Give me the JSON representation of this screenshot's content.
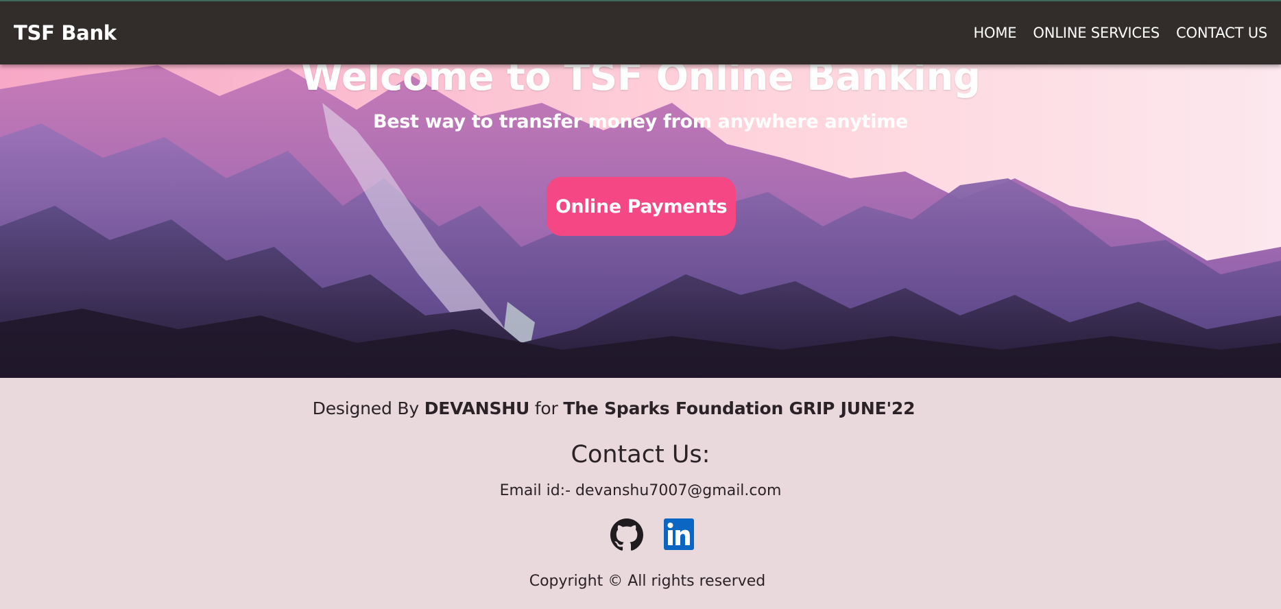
{
  "navbar": {
    "brand": "TSF Bank",
    "links": [
      "HOME",
      "ONLINE SERVICES",
      "CONTACT US"
    ]
  },
  "hero": {
    "title": "Welcome to TSF Online Banking",
    "subtitle": "Best way to transfer money from anywhere anytime",
    "cta_label": "Online Payments"
  },
  "footer": {
    "credit_prefix": "Designed By ",
    "credit_author": "DEVANSHU",
    "credit_middle": " for ",
    "credit_org": "The Sparks Foundation GRIP JUNE'22",
    "contact_heading": "Contact Us:",
    "email_line": "Email id:- devanshu7007@gmail.com",
    "social_icons": [
      "github-icon",
      "linkedin-icon"
    ],
    "copyright": "Copyright © All rights reserved"
  },
  "colors": {
    "navbar_bg": "#322d2a",
    "cta_bg": "#f54783",
    "footer_bg": "#e9d9dd",
    "linkedin_blue": "#0a66c2"
  }
}
